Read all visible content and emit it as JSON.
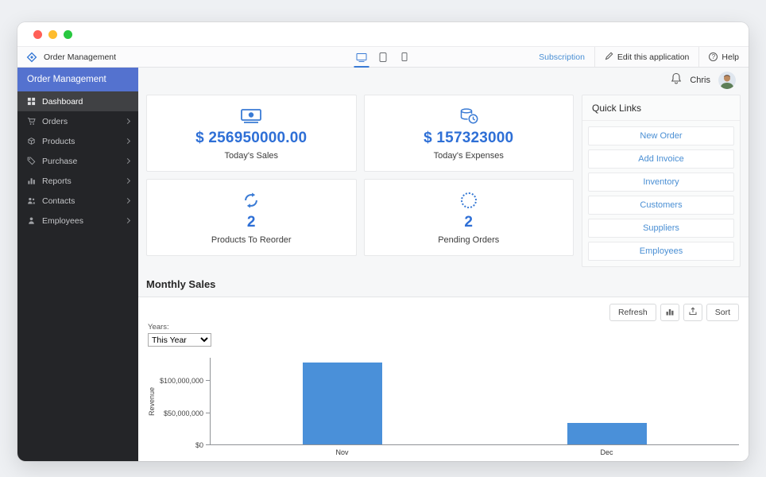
{
  "appbar": {
    "app_title": "Order Management",
    "subscription_label": "Subscription",
    "edit_label": "Edit this application",
    "help_label": "Help"
  },
  "sidebar": {
    "header": "Order Management",
    "items": [
      {
        "label": "Dashboard"
      },
      {
        "label": "Orders"
      },
      {
        "label": "Products"
      },
      {
        "label": "Purchase"
      },
      {
        "label": "Reports"
      },
      {
        "label": "Contacts"
      },
      {
        "label": "Employees"
      }
    ]
  },
  "userbar": {
    "username": "Chris"
  },
  "cards": [
    {
      "value": "$ 256950000.00",
      "label": "Today's Sales"
    },
    {
      "value": "$ 157323000",
      "label": "Today's Expenses"
    },
    {
      "value": "2",
      "label": "Products To Reorder"
    },
    {
      "value": "2",
      "label": "Pending Orders"
    }
  ],
  "quick_links": {
    "title": "Quick Links",
    "links": [
      "New Order",
      "Add Invoice",
      "Inventory",
      "Customers",
      "Suppliers",
      "Employees"
    ]
  },
  "monthly_sales": {
    "title": "Monthly Sales",
    "toolbar": {
      "refresh_label": "Refresh",
      "sort_label": "Sort"
    },
    "years_label": "Years:",
    "year_filter_value": "This Year"
  },
  "chart_data": {
    "type": "bar",
    "categories": [
      "Nov",
      "Dec"
    ],
    "values": [
      127000000,
      33000000
    ],
    "title": "Monthly Sales",
    "xlabel": "",
    "ylabel": "Revenue",
    "ylim": [
      0,
      135000000
    ],
    "yticks": [
      {
        "value": 0,
        "label": "$0"
      },
      {
        "value": 50000000,
        "label": "$50,000,000"
      },
      {
        "value": 100000000,
        "label": "$100,000,000"
      }
    ],
    "grid": false,
    "legend": false,
    "bar_color": "#4a90d9"
  },
  "colors": {
    "accent_blue": "#2e6fd6",
    "link_blue": "#4a8fd4",
    "sidebar_header_blue": "#5472cf",
    "bar_blue": "#4a90d9"
  }
}
